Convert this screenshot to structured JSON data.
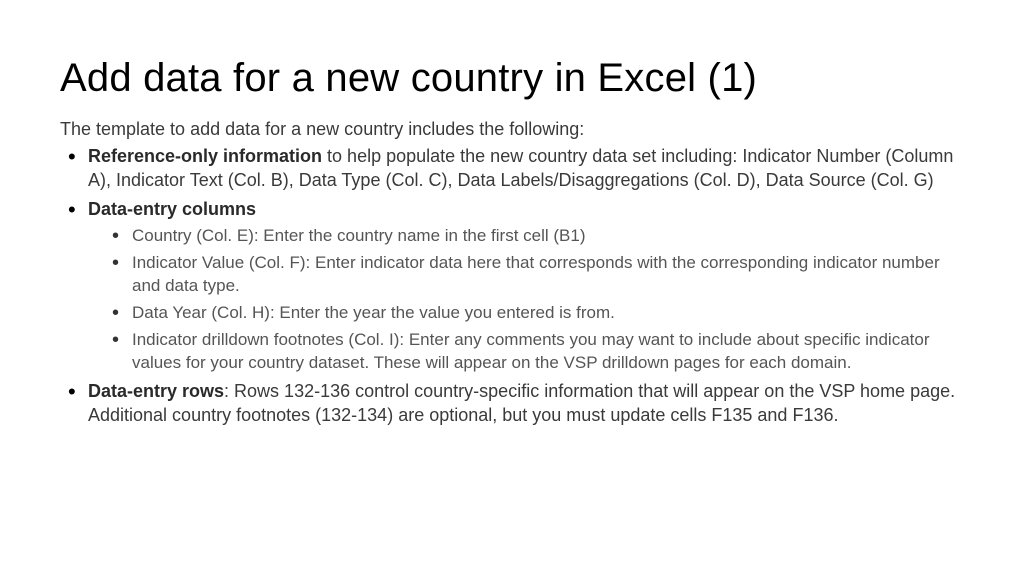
{
  "title": "Add data for a new country in Excel (1)",
  "intro": "The template to add data for a new country includes the following:",
  "items": [
    {
      "bold": "Reference-only information",
      "rest": " to help populate the new country data set including: Indicator Number (Column A), Indicator Text (Col. B), Data Type (Col. C), Data Labels/Disaggregations (Col. D), Data Source (Col. G)"
    },
    {
      "bold": "Data-entry columns",
      "rest": "",
      "sub": [
        "Country (Col. E): Enter the country name in the first cell (B1)",
        "Indicator Value (Col. F): Enter indicator data here that corresponds with the corresponding indicator number and data type.",
        "Data Year (Col. H): Enter the year the value you entered is from.",
        "Indicator drilldown footnotes (Col. I): Enter any comments you may want to include about specific indicator values for your country dataset. These will appear on the VSP drilldown pages for each domain."
      ]
    },
    {
      "bold": "Data-entry rows",
      "rest": ": Rows 132-136 control country-specific information that will appear on the VSP home page. Additional country footnotes (132-134) are optional, but you must update cells F135 and F136."
    }
  ]
}
